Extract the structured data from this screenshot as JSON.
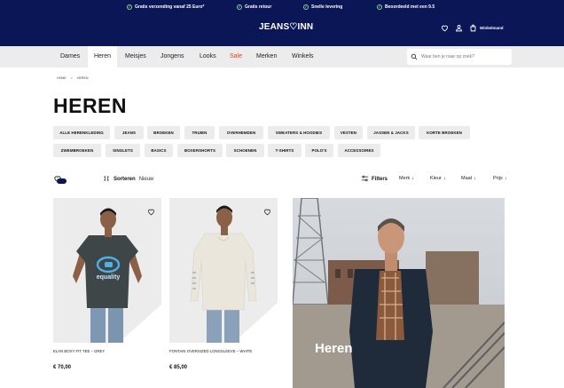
{
  "usps": [
    {
      "text": "Gratis verzending vanaf 25 Euro*"
    },
    {
      "text": "Gratis retour"
    },
    {
      "text": "Snelle levering"
    },
    {
      "text": "Beoordeeld met een 9.5"
    }
  ],
  "header": {
    "logo": "JEANS♡INN",
    "cart_label": "Winkelmand"
  },
  "nav": {
    "items": [
      "Dames",
      "Heren",
      "Meisjes",
      "Jongens",
      "Looks",
      "Sale",
      "Merken",
      "Winkels"
    ],
    "active": "Heren",
    "search_placeholder": "Waar ben je naar op zoek?"
  },
  "breadcrumb": {
    "home": "HOME",
    "separator": ">",
    "current": "HEREN"
  },
  "page_title": "HEREN",
  "chips": {
    "row1": [
      "ALLE HERENKLEDING",
      "JEANS",
      "BROEKEN",
      "TRUIEN",
      "OVERHEMDEN",
      "SWEATERS & HOODIES",
      "VESTEN",
      "JASSEN & JACKS",
      "KORTE BROEKEN"
    ],
    "row2": [
      "ZWEMBROEKEN",
      "SINGLETS",
      "BASICS",
      "BOXERSHORTS",
      "SCHOENEN",
      "T-SHIRTS",
      "POLO'S",
      "ACCESSOIRES"
    ]
  },
  "toolbar": {
    "sort_label": "Sorteren",
    "sort_value": "Nieuw",
    "filters_label": "Filters",
    "filters": [
      "Merk",
      "Kleur",
      "Maat",
      "Prijs"
    ]
  },
  "products": [
    {
      "name": "ELAN BOXY FIT TEE – GREY",
      "price": "€ 70,00",
      "print": "equality"
    },
    {
      "name": "FONTAIN OVERSIZED LONGSLEEVE – WHITE",
      "price": "€ 85,00"
    }
  ],
  "promo": {
    "title": "Heren"
  },
  "colors": {
    "brand_navy": "#0b1657",
    "usp_check": "#8fd18f",
    "sale_red": "#e0421b",
    "chip_bg": "#ececec",
    "nav_bg": "#ececec"
  },
  "icons": [
    "check-icon",
    "heart-icon",
    "user-icon",
    "bag-icon",
    "search-icon",
    "sort-icon",
    "filter-icon",
    "chevron-down-icon"
  ]
}
